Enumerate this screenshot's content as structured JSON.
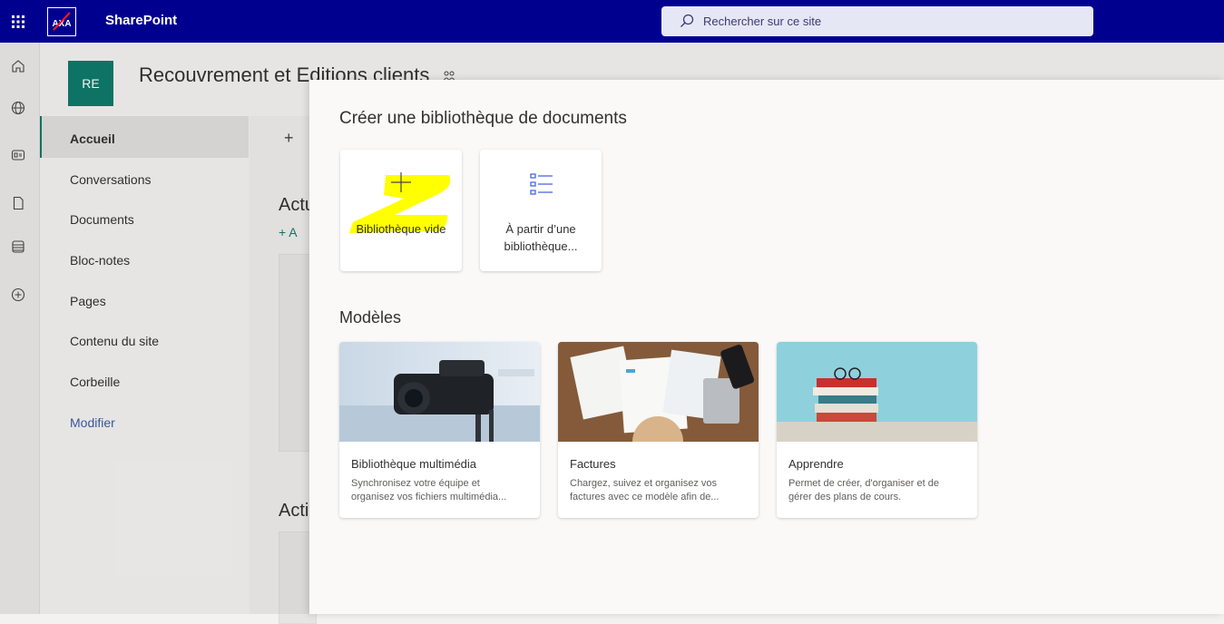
{
  "topbar": {
    "app_name": "SharePoint",
    "logo_text": "AXA",
    "search_placeholder": "Rechercher sur ce site"
  },
  "site": {
    "initials": "RE",
    "title": "Recouvrement et Editions clients"
  },
  "nav": {
    "items": [
      {
        "label": "Accueil"
      },
      {
        "label": "Conversations"
      },
      {
        "label": "Documents"
      },
      {
        "label": "Bloc-notes"
      },
      {
        "label": "Pages"
      },
      {
        "label": "Contenu du site"
      },
      {
        "label": "Corbeille"
      },
      {
        "label": "Modifier"
      }
    ]
  },
  "background": {
    "new_cmd": "+",
    "section1": "Actu",
    "add1": "+ A",
    "section2": "Acti"
  },
  "panel": {
    "title": "Créer une bibliothèque de documents",
    "options": [
      {
        "label": "Bibliothèque vide",
        "icon": "add-icon"
      },
      {
        "label_line1": "À partir d’une",
        "label_line2": "bibliothèque...",
        "icon": "list-icon"
      }
    ],
    "models_title": "Modèles",
    "templates": [
      {
        "title": "Bibliothèque multimédia",
        "desc1": "Synchronisez votre équipe et",
        "desc2": "organisez vos fichiers multimédia..."
      },
      {
        "title": "Factures",
        "desc1": "Chargez, suivez et organisez vos",
        "desc2": "factures avec ce modèle afin de..."
      },
      {
        "title": "Apprendre",
        "desc1": "Permet de créer, d'organiser et de",
        "desc2": "gérer des plans de cours."
      }
    ]
  },
  "colors": {
    "topbar": "#00008f",
    "site_logo": "#0f7a6a",
    "highlight": "#ffff00",
    "modifier_link": "#3b5ba5"
  }
}
